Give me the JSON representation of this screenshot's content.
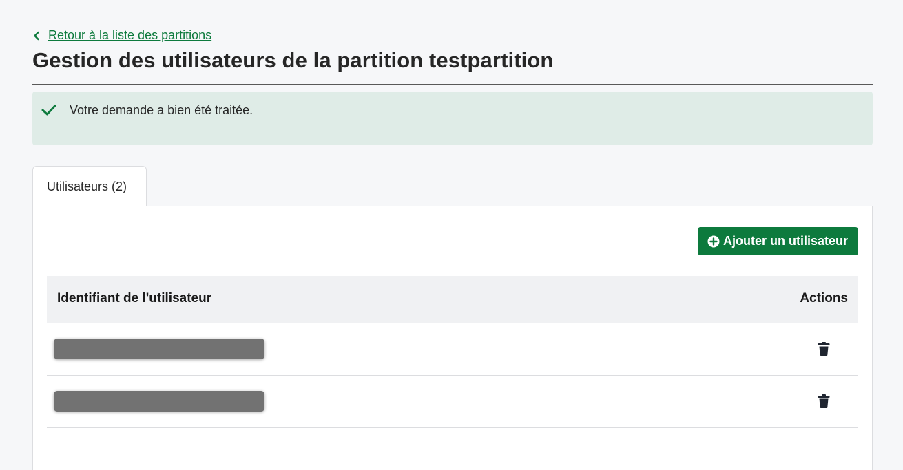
{
  "back_link": {
    "label": "Retour à la liste des partitions",
    "icon": "chevron-left-icon"
  },
  "page_title": "Gestion des utilisateurs de la partition testpartition",
  "alert": {
    "icon": "check-icon",
    "message": "Votre demande a bien été traitée."
  },
  "tabs": [
    {
      "label": "Utilisateurs (2)",
      "active": true
    }
  ],
  "toolbar": {
    "add_user_label": "Ajouter un utilisateur",
    "add_icon": "plus-circle-icon"
  },
  "table": {
    "columns": [
      "Identifiant de l'utilisateur",
      "Actions"
    ],
    "rows": [
      {
        "identifier": "",
        "redacted": true,
        "action_icon": "trash-icon"
      },
      {
        "identifier": "",
        "redacted": true,
        "action_icon": "trash-icon"
      }
    ]
  },
  "colors": {
    "primary_green": "#0d7a3d",
    "success_bg": "#dfece7",
    "page_bg": "#f6f7f9",
    "table_header_bg": "#f0f1f3"
  }
}
